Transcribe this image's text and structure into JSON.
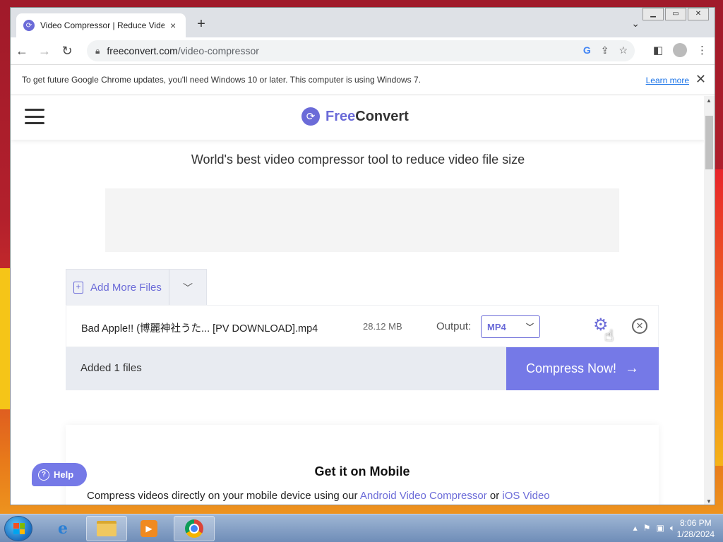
{
  "browser": {
    "tab_title": "Video Compressor | Reduce Vide",
    "tab_close": "×",
    "new_tab": "+",
    "url_host": "freeconvert.com",
    "url_path": "/video-compressor",
    "info_message": "To get future Google Chrome updates, you'll need Windows 10 or later. This computer is using Windows 7.",
    "learn_more": "Learn more",
    "info_close": "✕"
  },
  "site": {
    "logo_free": "Free",
    "logo_convert": "Convert",
    "subtitle": "World's best video compressor tool to reduce video file size",
    "add_more_label": "Add More Files"
  },
  "file": {
    "name": "Bad Apple!! (博麗神社うた... [PV DOWNLOAD].mp4",
    "size": "28.12 MB",
    "output_label": "Output:",
    "output_value": "MP4"
  },
  "actions": {
    "added_label": "Added 1 files",
    "compress_label": "Compress Now!"
  },
  "mobile": {
    "title": "Get it on Mobile",
    "text_prefix": "Compress videos directly on your mobile device using our ",
    "android_link": "Android Video Compressor",
    "text_or": " or ",
    "ios_link": "iOS Video"
  },
  "help": {
    "label": "Help"
  },
  "taskbar": {
    "time": "8:06 PM",
    "date": "1/28/2024"
  },
  "colors": {
    "brand": "#6b6bd8",
    "compress_button": "#7579e7"
  }
}
